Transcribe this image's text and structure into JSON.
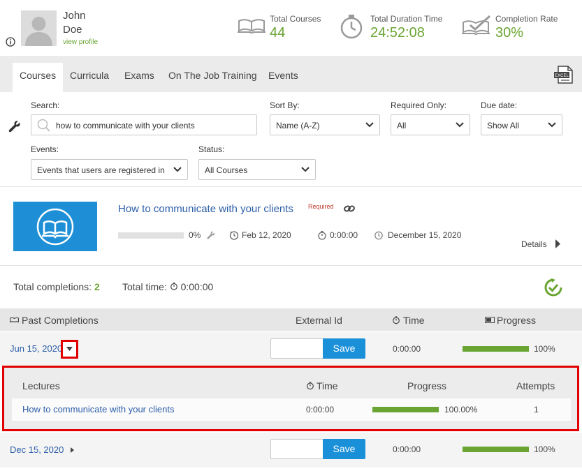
{
  "user": {
    "first_name": "John",
    "last_name": "Doe",
    "profile_link": "view profile"
  },
  "stats": [
    {
      "label": "Total Courses",
      "value": "44",
      "icon": "book-icon"
    },
    {
      "label": "Total Duration Time",
      "value": "24:52:08",
      "icon": "stopwatch-icon"
    },
    {
      "label": "Completion Rate",
      "value": "30%",
      "icon": "book-check-icon"
    }
  ],
  "tabs": [
    "Courses",
    "Curricula",
    "Exams",
    "On The Job Training",
    "Events"
  ],
  "export_label": "EXCEL",
  "filters": {
    "search_label": "Search:",
    "search_value": "how to communicate with your clients",
    "sort_label": "Sort By:",
    "sort_value": "Name (A-Z)",
    "required_label": "Required Only:",
    "required_value": "All",
    "due_label": "Due date:",
    "due_value": "Show All",
    "events_label": "Events:",
    "events_value": "Events that users are registered in",
    "status_label": "Status:",
    "status_value": "All Courses"
  },
  "course": {
    "title": "How to communicate with your clients",
    "required": "Required",
    "progress_text": "0%",
    "progress": 0,
    "assigned_date": "Feb 12, 2020",
    "duration": "0:00:00",
    "due_date": "December 15, 2020",
    "details_label": "Details"
  },
  "summary": {
    "completions_label": "Total completions:",
    "completions_value": "2",
    "time_label": "Total time:",
    "time_value": "0:00:00"
  },
  "past_completions": {
    "headers": {
      "title": "Past Completions",
      "external_id": "External Id",
      "time": "Time",
      "progress": "Progress"
    },
    "rows": [
      {
        "date": "Jun 15, 2020",
        "save_label": "Save",
        "time": "0:00:00",
        "progress_text": "100%",
        "progress": 1.0
      },
      {
        "date": "Dec 15, 2020",
        "save_label": "Save",
        "time": "0:00:00",
        "progress_text": "100%",
        "progress": 1.0
      }
    ]
  },
  "lectures": {
    "headers": {
      "title": "Lectures",
      "time": "Time",
      "progress": "Progress",
      "attempts": "Attempts"
    },
    "rows": [
      {
        "title": "How to communicate with your clients",
        "time": "0:00:00",
        "progress_text": "100.00%",
        "progress": 1.0,
        "attempts": "1"
      }
    ]
  },
  "colors": {
    "accent_green": "#6aa533",
    "link_blue": "#2c5ea8",
    "button_blue": "#1a90d9",
    "highlight_red": "#e00000"
  }
}
